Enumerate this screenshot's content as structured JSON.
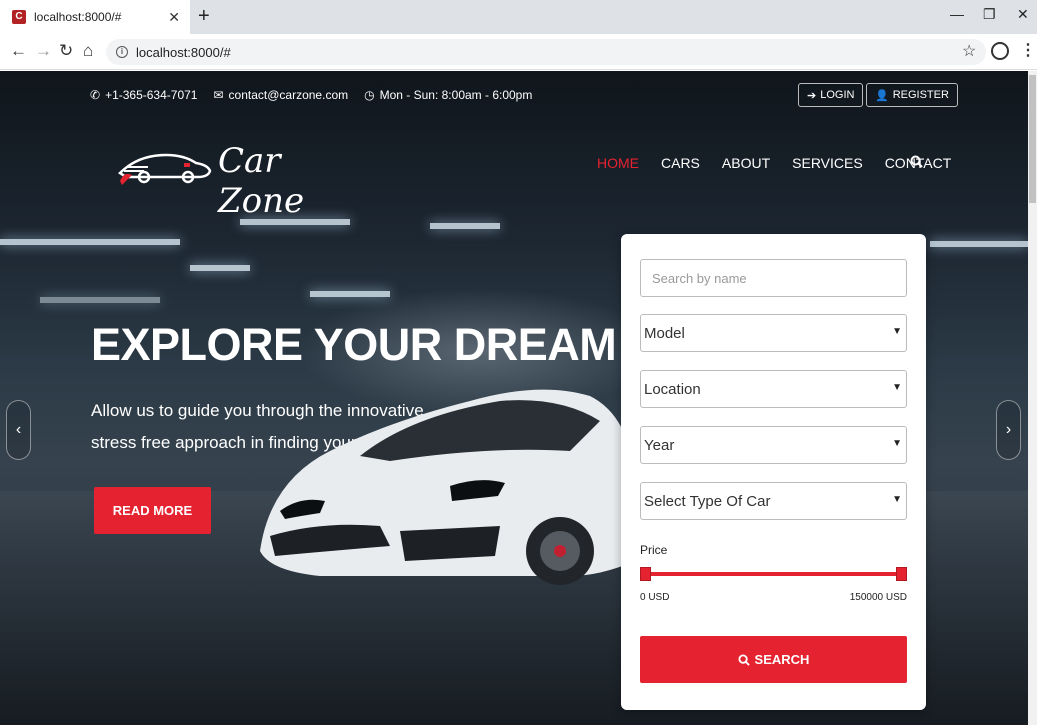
{
  "browser": {
    "tab_title": "localhost:8000/#",
    "favicon_letter": "C",
    "url": "localhost:8000/#"
  },
  "topbar": {
    "phone": "+1-365-634-7071",
    "email": "contact@carzone.com",
    "hours": "Mon - Sun: 8:00am - 6:00pm",
    "login_label": "LOGIN",
    "register_label": "REGISTER"
  },
  "brand": {
    "name": "Car Zone"
  },
  "nav": {
    "items": [
      {
        "label": "HOME",
        "active": true
      },
      {
        "label": "CARS"
      },
      {
        "label": "ABOUT"
      },
      {
        "label": "SERVICES"
      },
      {
        "label": "CONTACT"
      }
    ]
  },
  "hero": {
    "title": "EXPLORE YOUR DREAM CAR",
    "subtitle": "Allow us to guide you through the innovative stress free approach in finding your dream car.",
    "cta_label": "READ MORE"
  },
  "search_form": {
    "name_placeholder": "Search by name",
    "model_value": "Model",
    "location_value": "Location",
    "year_value": "Year",
    "type_value": "Select Type Of Car",
    "price_label": "Price",
    "price_min": "0 USD",
    "price_max": "150000 USD",
    "search_label": "SEARCH"
  },
  "colors": {
    "accent": "#e52330"
  }
}
